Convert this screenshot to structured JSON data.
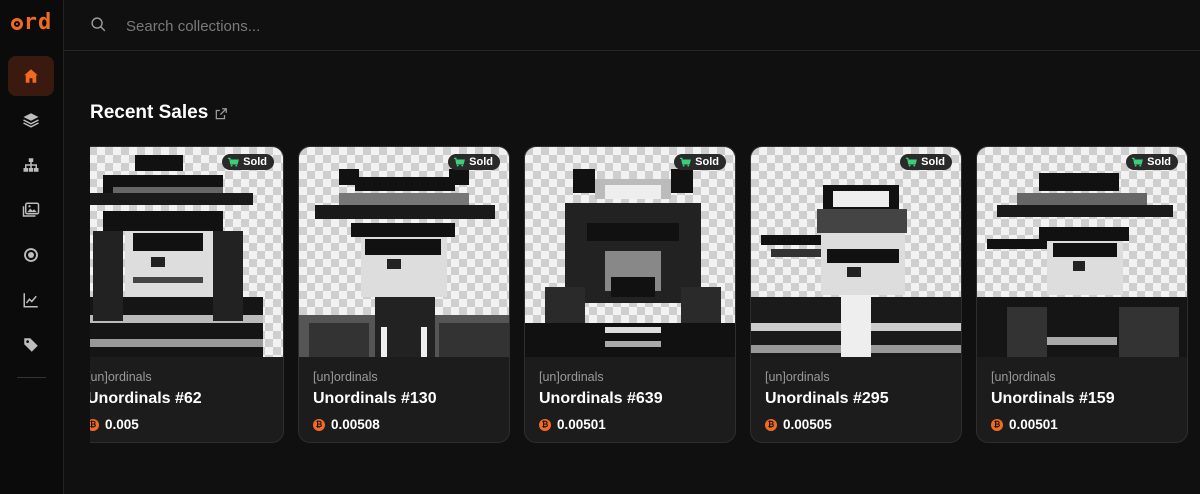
{
  "app": {
    "logo_text": "rd",
    "accent": "#f26a21"
  },
  "sidebar": {
    "items": [
      {
        "icon": "home-icon",
        "active": true
      },
      {
        "icon": "layers-icon",
        "active": false
      },
      {
        "icon": "sitemap-icon",
        "active": false
      },
      {
        "icon": "images-icon",
        "active": false
      },
      {
        "icon": "circle-dot-icon",
        "active": false
      },
      {
        "icon": "chart-line-icon",
        "active": false
      },
      {
        "icon": "tag-icon",
        "active": false
      }
    ]
  },
  "search": {
    "placeholder": "Search collections...",
    "value": ""
  },
  "section": {
    "title": "Recent Sales"
  },
  "cards": [
    {
      "collection": "[un]ordinals",
      "name": "Unordinals #62",
      "price": "0.005",
      "badge": "Sold"
    },
    {
      "collection": "[un]ordinals",
      "name": "Unordinals #130",
      "price": "0.00508",
      "badge": "Sold"
    },
    {
      "collection": "[un]ordinals",
      "name": "Unordinals #639",
      "price": "0.00501",
      "badge": "Sold"
    },
    {
      "collection": "[un]ordinals",
      "name": "Unordinals #295",
      "price": "0.00505",
      "badge": "Sold"
    },
    {
      "collection": "[un]ordinals",
      "name": "Unordinals #159",
      "price": "0.00501",
      "badge": "Sold"
    }
  ]
}
